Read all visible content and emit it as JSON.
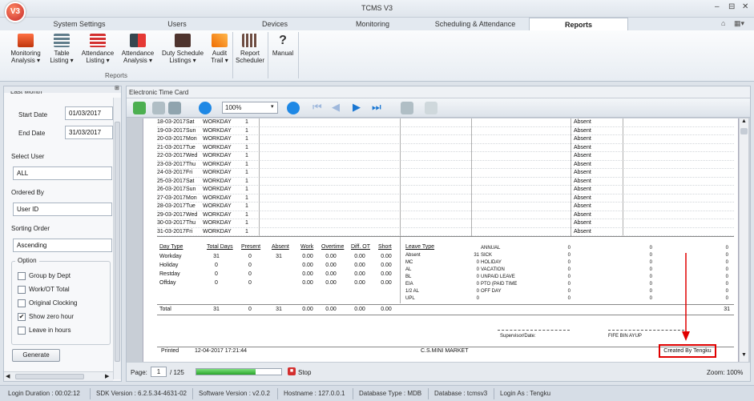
{
  "app": {
    "title": "TCMS V3",
    "logo_text": "V3",
    "window_controls": [
      "–",
      "⊟",
      "✕"
    ]
  },
  "tabs": [
    {
      "label": "System Settings"
    },
    {
      "label": "Users"
    },
    {
      "label": "Devices"
    },
    {
      "label": "Monitoring"
    },
    {
      "label": "Scheduling & Attendance"
    },
    {
      "label": "Reports"
    }
  ],
  "ribbon": {
    "buttons": [
      {
        "label1": "Monitoring",
        "label2": "Analysis ▾",
        "icon": "monitor-chart-icon",
        "color": "#d84315"
      },
      {
        "label1": "Table",
        "label2": "Listing ▾",
        "icon": "table-icon",
        "color": "#455a64"
      },
      {
        "label1": "Attendance",
        "label2": "Listing ▾",
        "icon": "list-icon",
        "color": "#c62828"
      },
      {
        "label1": "Attendance",
        "label2": "Analysis ▾",
        "icon": "people-analysis-icon",
        "color": "#37474f"
      },
      {
        "label1": "Duty Schedule",
        "label2": "Listings ▾",
        "icon": "briefcase-icon",
        "color": "#3e2723"
      },
      {
        "label1": "Audit",
        "label2": "Trail ▾",
        "icon": "audit-chart-icon",
        "color": "#e65100"
      },
      {
        "label1": "Report",
        "label2": "Scheduler",
        "icon": "calendar-icon",
        "color": "#5d4037"
      },
      {
        "label1": "Manual",
        "label2": "",
        "icon": "help-icon",
        "color": "#424242"
      }
    ],
    "group_label": "Reports"
  },
  "left": {
    "period_value": "Last Month",
    "start_label": "Start Date",
    "start_value": "01/03/2017",
    "end_label": "End Date",
    "end_value": "31/03/2017",
    "select_user_label": "Select User",
    "select_user_value": "ALL",
    "ordered_by_label": "Ordered By",
    "ordered_by_value": "User ID",
    "sorting_label": "Sorting Order",
    "sorting_value": "Ascending",
    "option_label": "Option",
    "options": [
      {
        "label": "Group by Dept",
        "checked": false
      },
      {
        "label": "Work/OT Total",
        "checked": false
      },
      {
        "label": "Original Clocking",
        "checked": false
      },
      {
        "label": "Show zero hour",
        "checked": true
      },
      {
        "label": "Leave in hours",
        "checked": false
      }
    ],
    "generate_label": "Generate"
  },
  "viewer": {
    "title": "Electronic Time Card",
    "zoom": "100%",
    "page_label": "Page:",
    "page_current": "1",
    "page_total": "/ 125",
    "stop_label": "Stop",
    "zoom_status": "Zoom: 100%",
    "progress": 0.7
  },
  "report": {
    "days": [
      {
        "date": "18-03-2017",
        "dow": "Sat",
        "type": "WORKDAY",
        "n": "1",
        "status": "Absent"
      },
      {
        "date": "19-03-2017",
        "dow": "Sun",
        "type": "WORKDAY",
        "n": "1",
        "status": "Absent"
      },
      {
        "date": "20-03-2017",
        "dow": "Mon",
        "type": "WORKDAY",
        "n": "1",
        "status": "Absent"
      },
      {
        "date": "21-03-2017",
        "dow": "Tue",
        "type": "WORKDAY",
        "n": "1",
        "status": "Absent"
      },
      {
        "date": "22-03-2017",
        "dow": "Wed",
        "type": "WORKDAY",
        "n": "1",
        "status": "Absent"
      },
      {
        "date": "23-03-2017",
        "dow": "Thu",
        "type": "WORKDAY",
        "n": "1",
        "status": "Absent"
      },
      {
        "date": "24-03-2017",
        "dow": "Fri",
        "type": "WORKDAY",
        "n": "1",
        "status": "Absent"
      },
      {
        "date": "25-03-2017",
        "dow": "Sat",
        "type": "WORKDAY",
        "n": "1",
        "status": "Absent"
      },
      {
        "date": "26-03-2017",
        "dow": "Sun",
        "type": "WORKDAY",
        "n": "1",
        "status": "Absent"
      },
      {
        "date": "27-03-2017",
        "dow": "Mon",
        "type": "WORKDAY",
        "n": "1",
        "status": "Absent"
      },
      {
        "date": "28-03-2017",
        "dow": "Tue",
        "type": "WORKDAY",
        "n": "1",
        "status": "Absent"
      },
      {
        "date": "29-03-2017",
        "dow": "Wed",
        "type": "WORKDAY",
        "n": "1",
        "status": "Absent"
      },
      {
        "date": "30-03-2017",
        "dow": "Thu",
        "type": "WORKDAY",
        "n": "1",
        "status": "Absent"
      },
      {
        "date": "31-03-2017",
        "dow": "Fri",
        "type": "WORKDAY",
        "n": "1",
        "status": "Absent"
      }
    ],
    "summary_headers": [
      "Day Type",
      "Total Days",
      "Present",
      "Absent",
      "Work",
      "Overtime",
      "Diff. OT",
      "Short"
    ],
    "summary_rows": [
      [
        "Workday",
        "31",
        "0",
        "31",
        "0.00",
        "0.00",
        "0.00",
        "0.00"
      ],
      [
        "Holiday",
        "0",
        "0",
        "",
        "0.00",
        "0.00",
        "0.00",
        "0.00"
      ],
      [
        "Restday",
        "0",
        "0",
        "",
        "0.00",
        "0.00",
        "0.00",
        "0.00"
      ],
      [
        "Offday",
        "0",
        "0",
        "",
        "0.00",
        "0.00",
        "0.00",
        "0.00"
      ]
    ],
    "total_row": [
      "Total",
      "31",
      "0",
      "31",
      "0.00",
      "0.00",
      "0.00",
      "0.00"
    ],
    "leave_header": "Leave Type",
    "leave_rows": [
      {
        "type": "",
        "val": "",
        "desc": "ANNUAL",
        "a": "0",
        "b": "0",
        "c": "0"
      },
      {
        "type": "Absent",
        "val": "31",
        "desc": "SICK",
        "a": "0",
        "b": "0",
        "c": "0"
      },
      {
        "type": "MC",
        "val": "0",
        "desc": "HOLIDAY",
        "a": "0",
        "b": "0",
        "c": "0"
      },
      {
        "type": "AL",
        "val": "0",
        "desc": "VACATION",
        "a": "0",
        "b": "0",
        "c": "0"
      },
      {
        "type": "BL",
        "val": "0",
        "desc": "UNPAID LEAVE",
        "a": "0",
        "b": "0",
        "c": "0"
      },
      {
        "type": "EIA",
        "val": "0",
        "desc": "PTO (PAID TIME",
        "a": "0",
        "b": "0",
        "c": "0"
      },
      {
        "type": "1/2 AL",
        "val": "0",
        "desc": "OFF DAY",
        "a": "0",
        "b": "0",
        "c": "0"
      },
      {
        "type": "UPL",
        "val": "0",
        "desc": "",
        "a": "0",
        "b": "0",
        "c": "0"
      }
    ],
    "leave_total": "31",
    "supervisor_label": "Supervisor/Date:",
    "employee_name": "FIFE BIN AYUP",
    "printed_label": "Printed",
    "printed_value": "12-04-2017 17:21:44",
    "company": "C.S.MINI MARKET",
    "created_by": "Created By Tengku",
    "highlight_color": "#e00000"
  },
  "status": {
    "items": [
      "Login Duration : 00:02:12",
      "SDK Version : 6.2.5.34-4631-02",
      "Software Version : v2.0.2",
      "Hostname : 127.0.0.1",
      "Database Type : MDB",
      "Database : tcmsv3",
      "Login As : Tengku"
    ]
  }
}
